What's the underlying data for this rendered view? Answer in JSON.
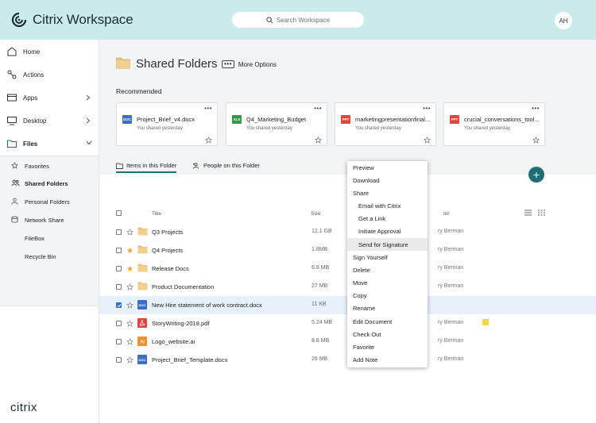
{
  "header": {
    "brand": "Citrix Workspace",
    "search_placeholder": "Search Workspace",
    "avatar_initials": "AH",
    "bg_color": "#c9ecea"
  },
  "sidebar": {
    "items": [
      {
        "label": "Home",
        "icon": "home-icon"
      },
      {
        "label": "Actions",
        "icon": "actions-icon"
      },
      {
        "label": "Apps",
        "icon": "apps-icon"
      },
      {
        "label": "Desktop",
        "icon": "desktop-icon"
      },
      {
        "label": "Files",
        "icon": "folder-icon"
      }
    ],
    "sub_items": [
      {
        "label": "Favorites",
        "icon": "star-icon"
      },
      {
        "label": "Shared Folders",
        "icon": "people-icon"
      },
      {
        "label": "Personal Folders",
        "icon": "person-icon"
      },
      {
        "label": "Network Share",
        "icon": "database-icon"
      },
      {
        "label": "FileBox",
        "icon": ""
      },
      {
        "label": "Recycle Bin",
        "icon": ""
      }
    ],
    "footer_logo": "citrix"
  },
  "main": {
    "title": "Shared Folders",
    "more_options": "More Options",
    "recommended_label": "Recommended",
    "recommended": [
      {
        "name": "Project_Brief_v4.docx",
        "sub": "You shared yesterday",
        "badge": "DOC",
        "color": "#3e6ec1"
      },
      {
        "name": "Q4_Marketing_Budget",
        "sub": "You shared yesterday",
        "badge": "XLS",
        "color": "#2e9b4a"
      },
      {
        "name": "marketingpresentationfinal...",
        "sub": "You shared yesterday",
        "badge": "PPT",
        "color": "#e1463a"
      },
      {
        "name": "crucial_conversations_tool...",
        "sub": "You shared yesterday",
        "badge": "PPT",
        "color": "#e1463a"
      }
    ],
    "tabs": [
      {
        "label": "Items in this Folder",
        "active": true
      },
      {
        "label": "People on this Folder",
        "active": false
      }
    ],
    "table": {
      "headers": {
        "title": "Title",
        "size": "Size",
        "editor": "tor"
      },
      "rows": [
        {
          "title": "Q3 Projects",
          "size": "12.1 GB",
          "editor": "ry Berman",
          "type": "folder",
          "starred": false
        },
        {
          "title": "Q4 Projects",
          "size": "1.8MB",
          "editor": "ry Berman",
          "type": "folder",
          "starred": true
        },
        {
          "title": "Release Docs",
          "size": "6.8 MB",
          "editor": "ry Berman",
          "type": "folder",
          "starred": true
        },
        {
          "title": "Product Documentation",
          "size": "27 MB",
          "editor": "ry Berman",
          "type": "folder",
          "starred": false
        },
        {
          "title": "New Hire statement of work contract.docx",
          "size": "11 KB",
          "editor": "",
          "type": "doc",
          "starred": false,
          "selected": true
        },
        {
          "title": "StoryWriting-2018.pdf",
          "size": "5.24 MB",
          "editor": "ry Berman",
          "type": "pdf",
          "starred": false
        },
        {
          "title": "Logo_website.ai",
          "size": "8.8 MB",
          "editor": "ry Berman",
          "type": "ai",
          "starred": false
        },
        {
          "title": "Project_Brief_Template.docx",
          "size": "26 MB",
          "editor": "ry Berman",
          "type": "doc",
          "starred": false
        }
      ]
    }
  },
  "context_menu": {
    "items": [
      {
        "label": "Preview"
      },
      {
        "label": "Download"
      },
      {
        "label": "Share"
      },
      {
        "label": "Email with Citrix",
        "indent": true
      },
      {
        "label": "Get a Link",
        "indent": true
      },
      {
        "label": "Initiate Approval",
        "indent": true
      },
      {
        "label": "Send for Signature",
        "indent": true,
        "highlighted": true
      },
      {
        "label": "Sign Yourself"
      },
      {
        "label": "Delete"
      },
      {
        "label": "Move"
      },
      {
        "label": "Copy"
      },
      {
        "label": "Rename"
      },
      {
        "label": "Edit Document"
      },
      {
        "label": "Check Out"
      },
      {
        "label": "Favorite"
      },
      {
        "label": "Add Note"
      }
    ]
  }
}
